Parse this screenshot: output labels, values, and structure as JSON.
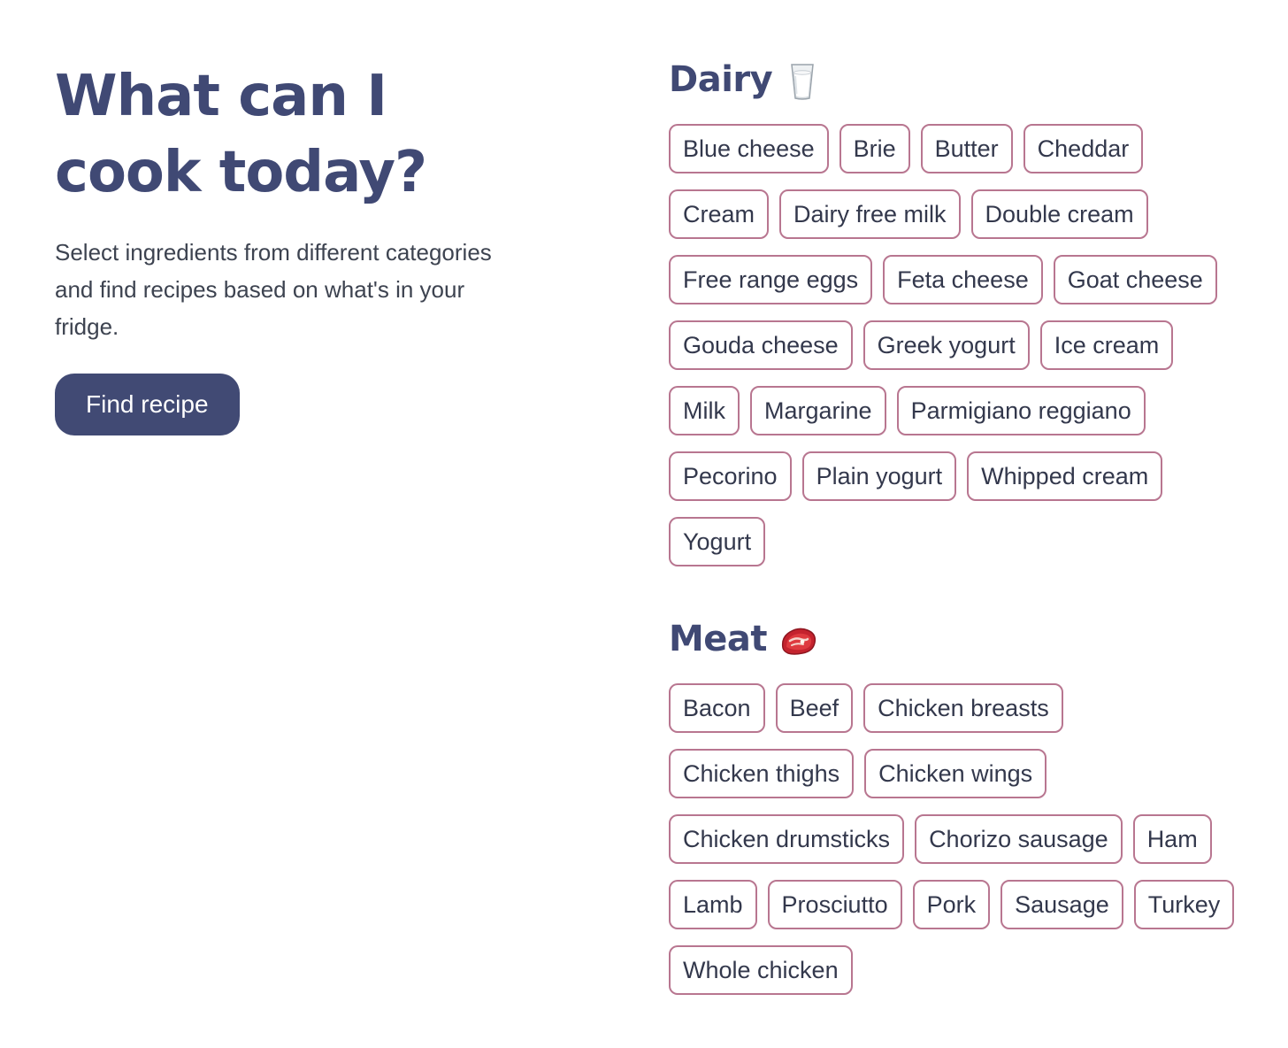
{
  "hero": {
    "title_line1": "What can I",
    "title_line2": "cook today?",
    "description": "Select ingredients from different categories and find recipes based on what's in your fridge.",
    "button_label": "Find recipe"
  },
  "categories": [
    {
      "title": "Dairy",
      "icon": "milk-glass-icon",
      "items": [
        "Blue cheese",
        "Brie",
        "Butter",
        "Cheddar",
        "Cream",
        "Dairy free milk",
        "Double cream",
        "Free range eggs",
        "Feta cheese",
        "Goat cheese",
        "Gouda cheese",
        "Greek yogurt",
        "Ice cream",
        "Milk",
        "Margarine",
        "Parmigiano reggiano",
        "Pecorino",
        "Plain yogurt",
        "Whipped cream",
        "Yogurt"
      ]
    },
    {
      "title": "Meat",
      "icon": "steak-icon",
      "items": [
        "Bacon",
        "Beef",
        "Chicken breasts",
        "Chicken thighs",
        "Chicken wings",
        "Chicken drumsticks",
        "Chorizo sausage",
        "Ham",
        "Lamb",
        "Prosciutto",
        "Pork",
        "Sausage",
        "Turkey",
        "Whole chicken"
      ]
    }
  ],
  "colors": {
    "heading": "#404974",
    "button_bg": "#414a74",
    "chip_border": "#b87690",
    "text": "#33384c"
  }
}
